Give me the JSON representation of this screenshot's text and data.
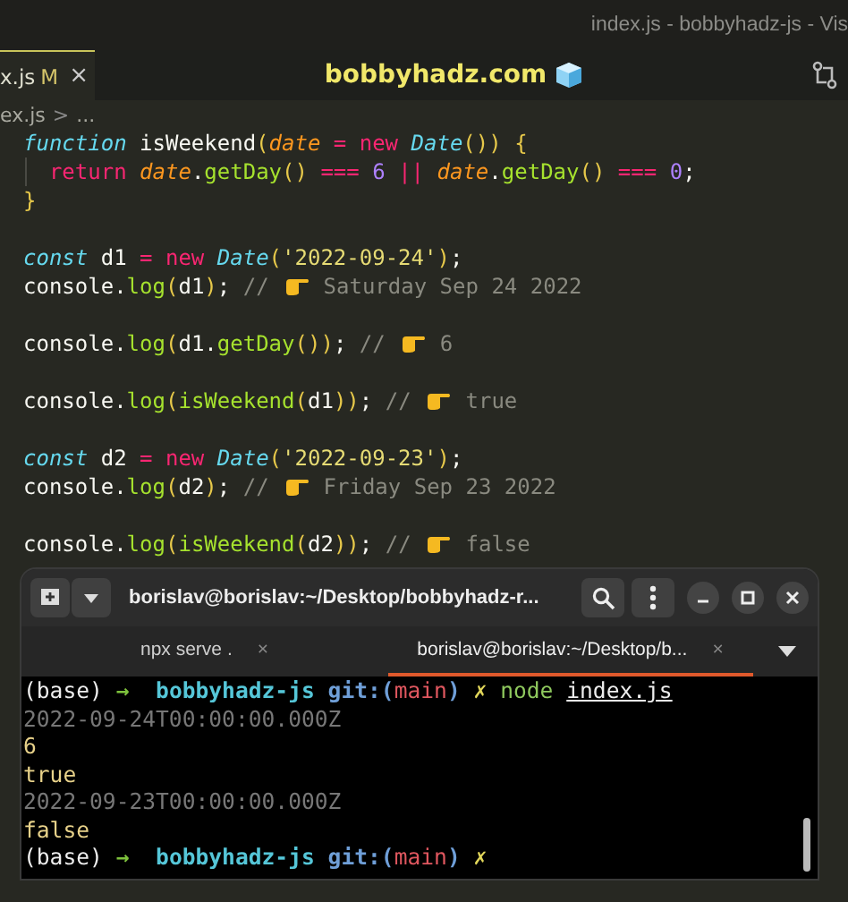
{
  "window": {
    "title": "index.js - bobbyhadz-js - Vis"
  },
  "editor_tab": {
    "label": "x.js",
    "status": "M",
    "close": "×",
    "selected": true
  },
  "banner": {
    "text": "bobbyhadz.com"
  },
  "breadcrumb": {
    "file": "ex.js",
    "separator": ">",
    "rest": "..."
  },
  "code_lines": [
    {
      "kind": "code",
      "tokens": [
        {
          "kind": "kw",
          "text": "function"
        },
        {
          "kind": "plain",
          "text": " isWeekend"
        },
        {
          "kind": "paren",
          "text": "("
        },
        {
          "kind": "param",
          "text": "date"
        },
        {
          "kind": "op",
          "text": " = new "
        },
        {
          "kind": "kw",
          "text": "Date"
        },
        {
          "kind": "paren",
          "text": "()) {"
        }
      ]
    },
    {
      "kind": "code",
      "tokens": [
        {
          "kind": "op",
          "text": "  return "
        },
        {
          "kind": "param",
          "text": "date"
        },
        {
          "kind": "plain",
          "text": "."
        },
        {
          "kind": "fn",
          "text": "getDay"
        },
        {
          "kind": "paren",
          "text": "()"
        },
        {
          "kind": "op",
          "text": " === "
        },
        {
          "kind": "num",
          "text": "6"
        },
        {
          "kind": "op",
          "text": " || "
        },
        {
          "kind": "param",
          "text": "date"
        },
        {
          "kind": "plain",
          "text": "."
        },
        {
          "kind": "fn",
          "text": "getDay"
        },
        {
          "kind": "paren",
          "text": "()"
        },
        {
          "kind": "op",
          "text": " === "
        },
        {
          "kind": "num",
          "text": "0"
        },
        {
          "kind": "plain",
          "text": ";"
        }
      ]
    },
    {
      "kind": "code",
      "tokens": [
        {
          "kind": "paren",
          "text": "}"
        }
      ]
    },
    {
      "kind": "blank"
    },
    {
      "kind": "code",
      "tokens": [
        {
          "kind": "kw",
          "text": "const"
        },
        {
          "kind": "plain",
          "text": " d1 "
        },
        {
          "kind": "op",
          "text": "= new "
        },
        {
          "kind": "kw",
          "text": "Date"
        },
        {
          "kind": "paren",
          "text": "("
        },
        {
          "kind": "str",
          "text": "'2022-09-24'"
        },
        {
          "kind": "paren",
          "text": ")"
        },
        {
          "kind": "plain",
          "text": ";"
        }
      ]
    },
    {
      "kind": "code",
      "tokens": [
        {
          "kind": "plain",
          "text": "console."
        },
        {
          "kind": "fn",
          "text": "log"
        },
        {
          "kind": "paren",
          "text": "("
        },
        {
          "kind": "plain",
          "text": "d1"
        },
        {
          "kind": "paren",
          "text": ")"
        },
        {
          "kind": "plain",
          "text": "; "
        },
        {
          "kind": "comment",
          "text": "// "
        },
        {
          "kind": "hand"
        },
        {
          "kind": "comment",
          "text": " Saturday Sep 24 2022"
        }
      ]
    },
    {
      "kind": "blank"
    },
    {
      "kind": "code",
      "tokens": [
        {
          "kind": "plain",
          "text": "console."
        },
        {
          "kind": "fn",
          "text": "log"
        },
        {
          "kind": "paren",
          "text": "("
        },
        {
          "kind": "plain",
          "text": "d1."
        },
        {
          "kind": "fn",
          "text": "getDay"
        },
        {
          "kind": "paren",
          "text": "())"
        },
        {
          "kind": "plain",
          "text": "; "
        },
        {
          "kind": "comment",
          "text": "// "
        },
        {
          "kind": "hand"
        },
        {
          "kind": "comment",
          "text": " 6"
        }
      ]
    },
    {
      "kind": "blank"
    },
    {
      "kind": "code",
      "tokens": [
        {
          "kind": "plain",
          "text": "console."
        },
        {
          "kind": "fn",
          "text": "log"
        },
        {
          "kind": "paren",
          "text": "("
        },
        {
          "kind": "fn",
          "text": "isWeekend"
        },
        {
          "kind": "paren",
          "text": "("
        },
        {
          "kind": "plain",
          "text": "d1"
        },
        {
          "kind": "paren",
          "text": "))"
        },
        {
          "kind": "plain",
          "text": "; "
        },
        {
          "kind": "comment",
          "text": "// "
        },
        {
          "kind": "hand"
        },
        {
          "kind": "comment",
          "text": " true"
        }
      ]
    },
    {
      "kind": "blank"
    },
    {
      "kind": "code",
      "tokens": [
        {
          "kind": "kw",
          "text": "const"
        },
        {
          "kind": "plain",
          "text": " d2 "
        },
        {
          "kind": "op",
          "text": "= new "
        },
        {
          "kind": "kw",
          "text": "Date"
        },
        {
          "kind": "paren",
          "text": "("
        },
        {
          "kind": "str",
          "text": "'2022-09-23'"
        },
        {
          "kind": "paren",
          "text": ")"
        },
        {
          "kind": "plain",
          "text": ";"
        }
      ]
    },
    {
      "kind": "code",
      "tokens": [
        {
          "kind": "plain",
          "text": "console."
        },
        {
          "kind": "fn",
          "text": "log"
        },
        {
          "kind": "paren",
          "text": "("
        },
        {
          "kind": "plain",
          "text": "d2"
        },
        {
          "kind": "paren",
          "text": ")"
        },
        {
          "kind": "plain",
          "text": "; "
        },
        {
          "kind": "comment",
          "text": "// "
        },
        {
          "kind": "hand"
        },
        {
          "kind": "comment",
          "text": " Friday Sep 23 2022"
        }
      ]
    },
    {
      "kind": "blank"
    },
    {
      "kind": "code",
      "tokens": [
        {
          "kind": "plain",
          "text": "console."
        },
        {
          "kind": "fn",
          "text": "log"
        },
        {
          "kind": "paren",
          "text": "("
        },
        {
          "kind": "fn",
          "text": "isWeekend"
        },
        {
          "kind": "paren",
          "text": "("
        },
        {
          "kind": "plain",
          "text": "d2"
        },
        {
          "kind": "paren",
          "text": "))"
        },
        {
          "kind": "plain",
          "text": "; "
        },
        {
          "kind": "comment",
          "text": "// "
        },
        {
          "kind": "hand"
        },
        {
          "kind": "comment",
          "text": " false"
        }
      ]
    }
  ],
  "terminal": {
    "title": "borislav@borislav:~/Desktop/bobbyhadz-r...",
    "tabs": [
      {
        "label": "npx serve .",
        "close": "×",
        "selected": false
      },
      {
        "label": "borislav@borislav:~/Desktop/b...",
        "close": "×",
        "selected": true
      }
    ],
    "lines": [
      [
        {
          "kind": "plain",
          "text": "(base) "
        },
        {
          "kind": "arrow",
          "text": "→ "
        },
        {
          "kind": "dir",
          "text": " bobbyhadz-js "
        },
        {
          "kind": "git",
          "text": "git:("
        },
        {
          "kind": "branch",
          "text": "main"
        },
        {
          "kind": "git",
          "text": ") "
        },
        {
          "kind": "dirty",
          "text": "✗ "
        },
        {
          "kind": "cmd",
          "text": "node "
        },
        {
          "kind": "link",
          "text": "index.js"
        }
      ],
      [
        {
          "kind": "dim",
          "text": "2022-09-24T00:00:00.000Z"
        }
      ],
      [
        {
          "kind": "yellow",
          "text": "6"
        }
      ],
      [
        {
          "kind": "yellow",
          "text": "true"
        }
      ],
      [
        {
          "kind": "dim",
          "text": "2022-09-23T00:00:00.000Z"
        }
      ],
      [
        {
          "kind": "yellow",
          "text": "false"
        }
      ],
      [
        {
          "kind": "plain",
          "text": "(base) "
        },
        {
          "kind": "arrow",
          "text": "→ "
        },
        {
          "kind": "dir",
          "text": " bobbyhadz-js "
        },
        {
          "kind": "git",
          "text": "git:("
        },
        {
          "kind": "branch",
          "text": "main"
        },
        {
          "kind": "git",
          "text": ") "
        },
        {
          "kind": "dirty",
          "text": "✗"
        }
      ]
    ]
  }
}
